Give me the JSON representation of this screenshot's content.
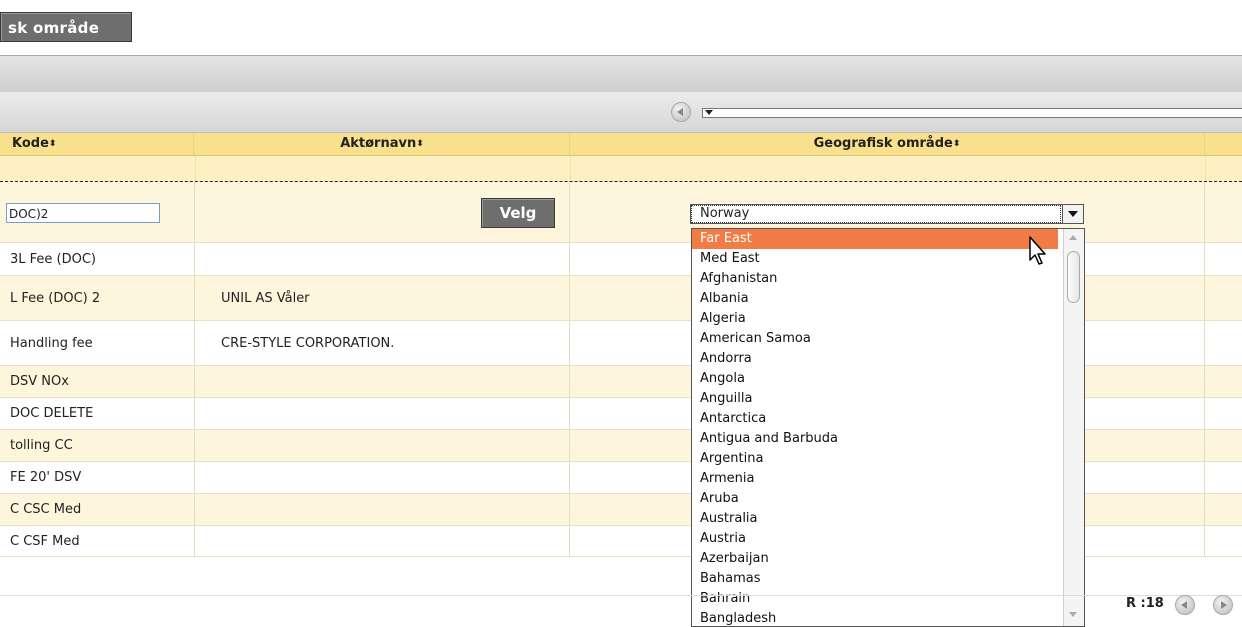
{
  "top_button": {
    "label": "sk område"
  },
  "pager": {
    "record_label": "R :18"
  },
  "columns": [
    {
      "label": "Kode"
    },
    {
      "label": "Aktørnavn"
    },
    {
      "label": "Geografisk område"
    }
  ],
  "edit_row": {
    "code_value": "DOC)2",
    "velg_label": "Velg",
    "geo_selected": "Norway"
  },
  "rows": [
    {
      "code": "3L Fee (DOC)",
      "actor": ""
    },
    {
      "code": "L Fee (DOC) 2",
      "actor": "UNIL AS Våler"
    },
    {
      "code": "Handling fee",
      "actor": "CRE-STYLE CORPORATION."
    },
    {
      "code": "DSV NOx",
      "actor": ""
    },
    {
      "code": "DOC DELETE",
      "actor": ""
    },
    {
      "code": "tolling CC",
      "actor": ""
    },
    {
      "code": "FE 20' DSV",
      "actor": ""
    },
    {
      "code": "C CSC Med",
      "actor": ""
    },
    {
      "code": "C CSF Med",
      "actor": ""
    }
  ],
  "dropdown_options": [
    "Far East",
    "Med East",
    "Afghanistan",
    "Albania",
    "Algeria",
    "American Samoa",
    "Andorra",
    "Angola",
    "Anguilla",
    "Antarctica",
    "Antigua and Barbuda",
    "Argentina",
    "Armenia",
    "Aruba",
    "Australia",
    "Austria",
    "Azerbaijan",
    "Bahamas",
    "Bahrain",
    "Bangladesh"
  ],
  "dropdown_highlighted_index": 0,
  "colors": {
    "highlight": "#f27c45",
    "header": "#f8e08c",
    "row_alt": "#fdf6dc"
  }
}
